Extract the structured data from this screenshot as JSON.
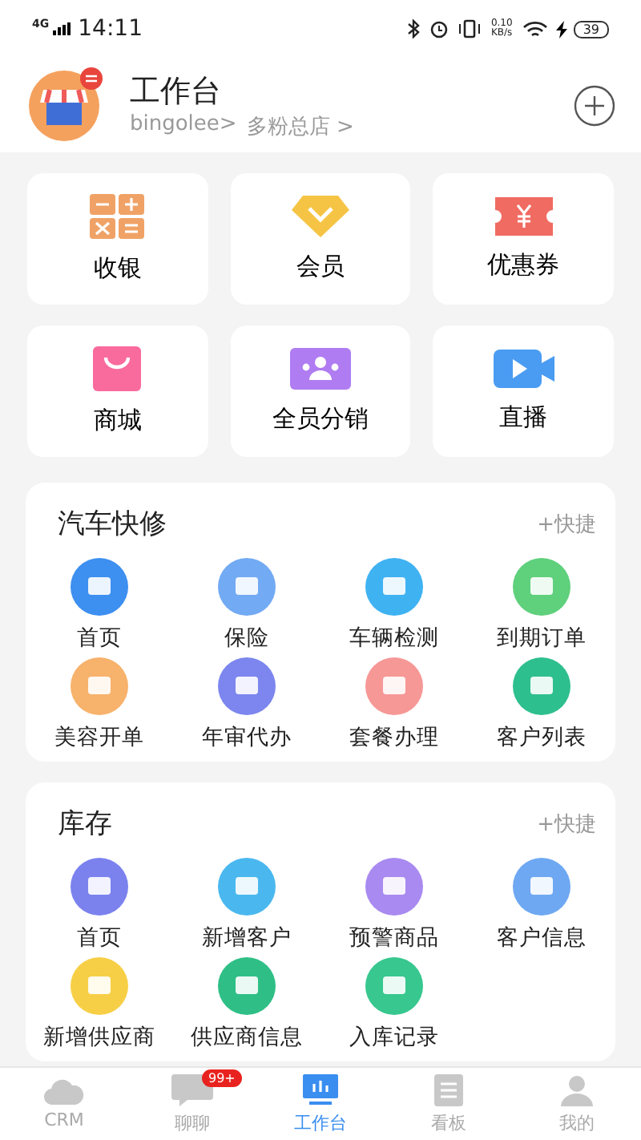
{
  "status_bar": {
    "network": "4G",
    "time": "14:11",
    "speed": "0.10",
    "speed_unit": "KB/s",
    "battery": "39"
  },
  "header": {
    "title": "工作台",
    "account": "bingolee>",
    "store": "多粉总店 >"
  },
  "tiles": [
    {
      "label": "收银",
      "kind": "calculator"
    },
    {
      "label": "会员",
      "kind": "diamond"
    },
    {
      "label": "优惠券",
      "kind": "ticket"
    },
    {
      "label": "商城",
      "kind": "bag"
    },
    {
      "label": "全员分销",
      "kind": "group"
    },
    {
      "label": "直播",
      "kind": "video"
    }
  ],
  "sections": [
    {
      "title": "汽车快修",
      "action": "+快捷",
      "items": [
        {
          "label": "首页",
          "color": "#3d8ff0"
        },
        {
          "label": "保险",
          "color": "#72aaf3"
        },
        {
          "label": "车辆检测",
          "color": "#3fb2f2"
        },
        {
          "label": "到期订单",
          "color": "#5fd07c"
        },
        {
          "label": "美容开单",
          "color": "#f7b26c"
        },
        {
          "label": "年审代办",
          "color": "#7c86ee"
        },
        {
          "label": "套餐办理",
          "color": "#f69896"
        },
        {
          "label": "客户列表",
          "color": "#2ebf8e"
        }
      ]
    },
    {
      "title": "库存",
      "action": "+快捷",
      "items": [
        {
          "label": "首页",
          "color": "#7b82ee"
        },
        {
          "label": "新增客户",
          "color": "#4ab8ef"
        },
        {
          "label": "预警商品",
          "color": "#a98af0"
        },
        {
          "label": "客户信息",
          "color": "#6ea8f2"
        },
        {
          "label": "新增供应商",
          "color": "#f7cf46"
        },
        {
          "label": "供应商信息",
          "color": "#2fbf86"
        },
        {
          "label": "入库记录",
          "color": "#37c78f"
        }
      ]
    }
  ],
  "tabbar": [
    {
      "label": "CRM",
      "kind": "cloud",
      "selected": false
    },
    {
      "label": "聊聊",
      "kind": "chat",
      "selected": false,
      "badge": "99+"
    },
    {
      "label": "工作台",
      "kind": "chart",
      "selected": true
    },
    {
      "label": "看板",
      "kind": "board",
      "selected": false
    },
    {
      "label": "我的",
      "kind": "person",
      "selected": false
    }
  ]
}
